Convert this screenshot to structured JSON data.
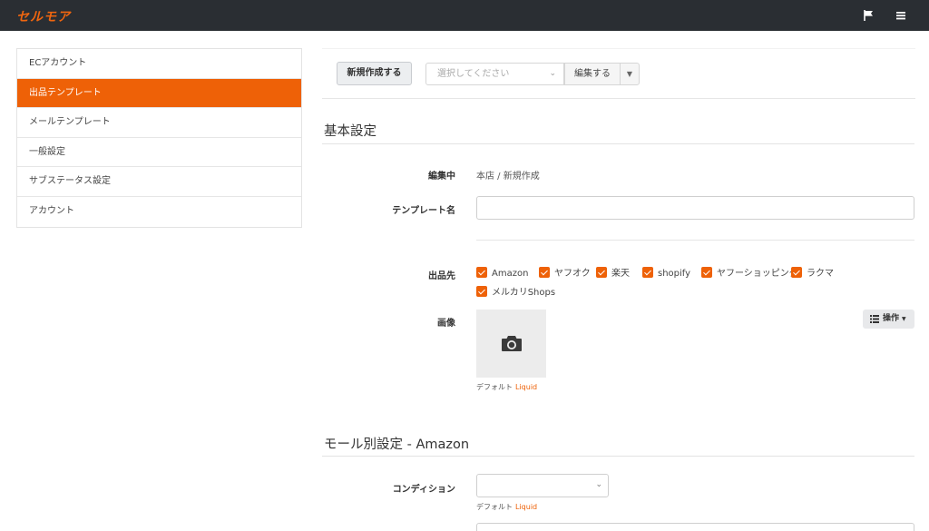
{
  "header": {
    "logo_text": "セルモア",
    "icons": [
      "flag-icon",
      "menu-icon"
    ]
  },
  "sidebar": {
    "items": [
      {
        "label": "ECアカウント",
        "active": false
      },
      {
        "label": "出品テンプレート",
        "active": true
      },
      {
        "label": "メールテンプレート",
        "active": false
      },
      {
        "label": "一般設定",
        "active": false
      },
      {
        "label": "サブステータス設定",
        "active": false
      },
      {
        "label": "アカウント",
        "active": false
      }
    ]
  },
  "toolbar": {
    "new_label": "新規作成する",
    "select_placeholder": "選択してください",
    "edit_label": "編集する"
  },
  "basic": {
    "title": "基本設定",
    "editing_label": "編集中",
    "editing_value": "本店 / 新規作成",
    "template_name_label": "テンプレート名",
    "template_name_value": "",
    "destinations_label": "出品先",
    "destinations": [
      {
        "label": "Amazon",
        "checked": true
      },
      {
        "label": "ヤフオク",
        "checked": true
      },
      {
        "label": "楽天",
        "checked": true
      },
      {
        "label": "shopify",
        "checked": true
      },
      {
        "label": "ヤフーショッピング",
        "checked": true
      },
      {
        "label": "ラクマ",
        "checked": true
      },
      {
        "label": "メルカリShops",
        "checked": true
      }
    ],
    "image_label": "画像",
    "operation_label": "操作",
    "default_text": "デフォルト",
    "liquid_text": "Liquid"
  },
  "mall": {
    "title": "モール別設定 - Amazon",
    "condition_label": "コンディション",
    "condition_value": "",
    "default_text": "デフォルト",
    "liquid_text": "Liquid"
  },
  "colors": {
    "accent": "#ee6107",
    "topbar": "#2a2e33"
  }
}
